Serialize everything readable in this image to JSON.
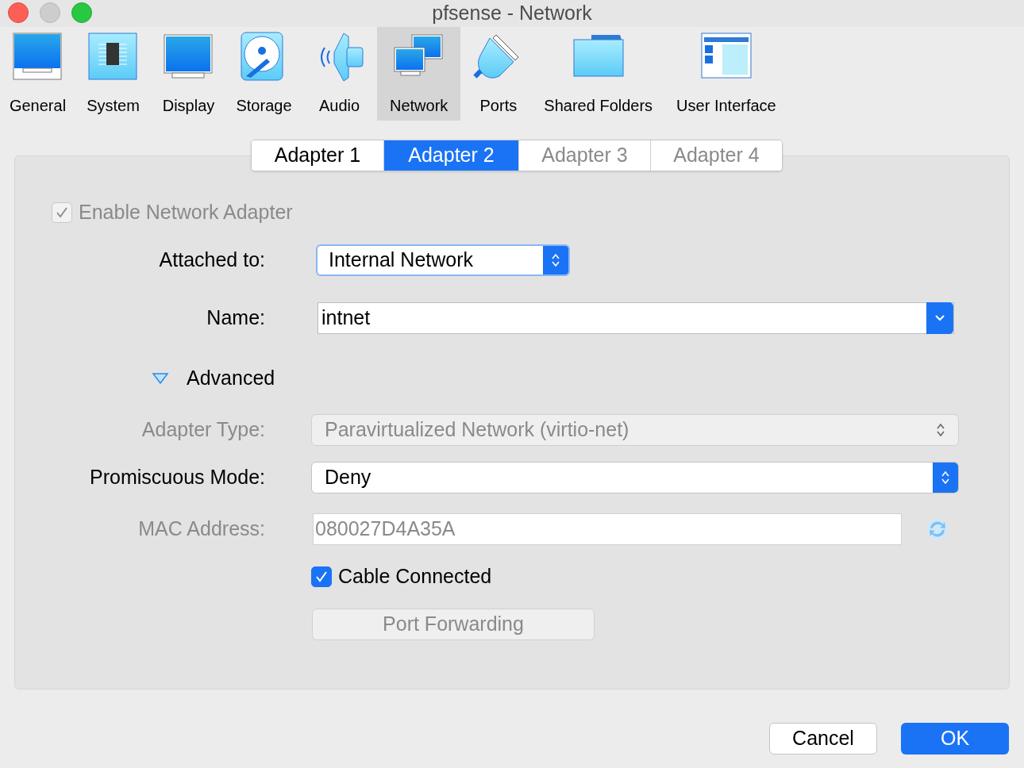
{
  "window": {
    "title": "pfsense - Network"
  },
  "toolbar": {
    "items": [
      {
        "label": "General",
        "selected": false
      },
      {
        "label": "System",
        "selected": false
      },
      {
        "label": "Display",
        "selected": false
      },
      {
        "label": "Storage",
        "selected": false
      },
      {
        "label": "Audio",
        "selected": false
      },
      {
        "label": "Network",
        "selected": true
      },
      {
        "label": "Ports",
        "selected": false
      },
      {
        "label": "Shared Folders",
        "selected": false
      },
      {
        "label": "User Interface",
        "selected": false
      }
    ]
  },
  "adapter_tabs": [
    {
      "label": "Adapter 1",
      "selected": false,
      "disabled": false
    },
    {
      "label": "Adapter 2",
      "selected": true,
      "disabled": false
    },
    {
      "label": "Adapter 3",
      "selected": false,
      "disabled": true
    },
    {
      "label": "Adapter 4",
      "selected": false,
      "disabled": true
    }
  ],
  "form": {
    "enable_adapter": {
      "label": "Enable Network Adapter",
      "checked": true,
      "disabled": true
    },
    "attached_to": {
      "label": "Attached to:",
      "value": "Internal Network"
    },
    "name": {
      "label": "Name:",
      "value": "intnet"
    },
    "advanced": {
      "label": "Advanced",
      "expanded": true
    },
    "adapter_type": {
      "label": "Adapter Type:",
      "value": "Paravirtualized Network (virtio-net)",
      "disabled": true
    },
    "promiscuous_mode": {
      "label": "Promiscuous Mode:",
      "value": "Deny",
      "disabled": false
    },
    "mac_address": {
      "label": "MAC Address:",
      "value": "080027D4A35A",
      "disabled": true
    },
    "cable_connected": {
      "label": "Cable Connected",
      "checked": true,
      "disabled": false
    },
    "port_forwarding": {
      "label": "Port Forwarding",
      "disabled": true
    }
  },
  "buttons": [
    {
      "label": "Cancel",
      "kind": "default"
    },
    {
      "label": "OK",
      "kind": "primary"
    }
  ]
}
